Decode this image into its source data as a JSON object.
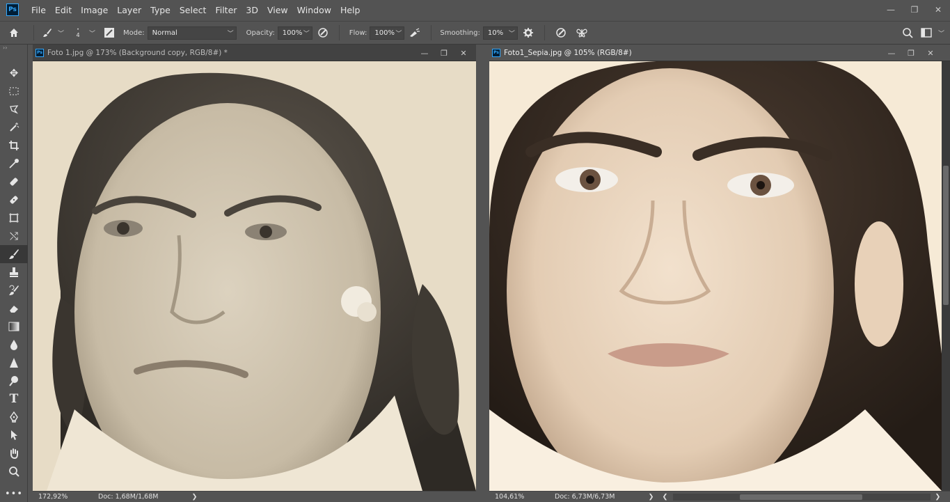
{
  "app": {
    "logo_text": "Ps"
  },
  "menu": [
    "File",
    "Edit",
    "Image",
    "Layer",
    "Type",
    "Select",
    "Filter",
    "3D",
    "View",
    "Window",
    "Help"
  ],
  "window_controls": {
    "minimize": "—",
    "restore": "❐",
    "close": "✕"
  },
  "options_bar": {
    "home_icon": "home-icon",
    "brush_size": "4",
    "mode_label": "Mode:",
    "mode_value": "Normal",
    "opacity_label": "Opacity:",
    "opacity_value": "100%",
    "flow_label": "Flow:",
    "flow_value": "100%",
    "smoothing_label": "Smoothing:",
    "smoothing_value": "10%"
  },
  "tools": [
    "move-tool",
    "marquee-tool",
    "lasso-tool",
    "magic-wand-tool",
    "crop-tool",
    "eyedropper-tool",
    "healing-brush-tool",
    "patch-tool",
    "frame-tool",
    "content-aware-move-tool",
    "brush-tool",
    "clone-stamp-tool",
    "history-brush-tool",
    "eraser-tool",
    "gradient-tool",
    "blur-tool",
    "sharpen-tool",
    "dodge-tool",
    "type-tool",
    "pen-tool",
    "path-selection-tool",
    "hand-tool",
    "zoom-tool",
    "more-tools"
  ],
  "documents": [
    {
      "title": "Foto 1.jpg @ 173% (Background copy, RGB/8#) *",
      "zoom": "172,92%",
      "doc_info": "Doc: 1,68M/1,68M",
      "arrow": "❯"
    },
    {
      "title": "Foto1_Sepia.jpg @ 105% (RGB/8#)",
      "zoom": "104,61%",
      "doc_info": "Doc: 6,73M/6,73M",
      "arrow": "❯",
      "arrow_left": "❮",
      "arrow_right": "❯"
    }
  ],
  "doc_controls": {
    "minimize": "—",
    "restore": "❐",
    "close": "✕"
  }
}
